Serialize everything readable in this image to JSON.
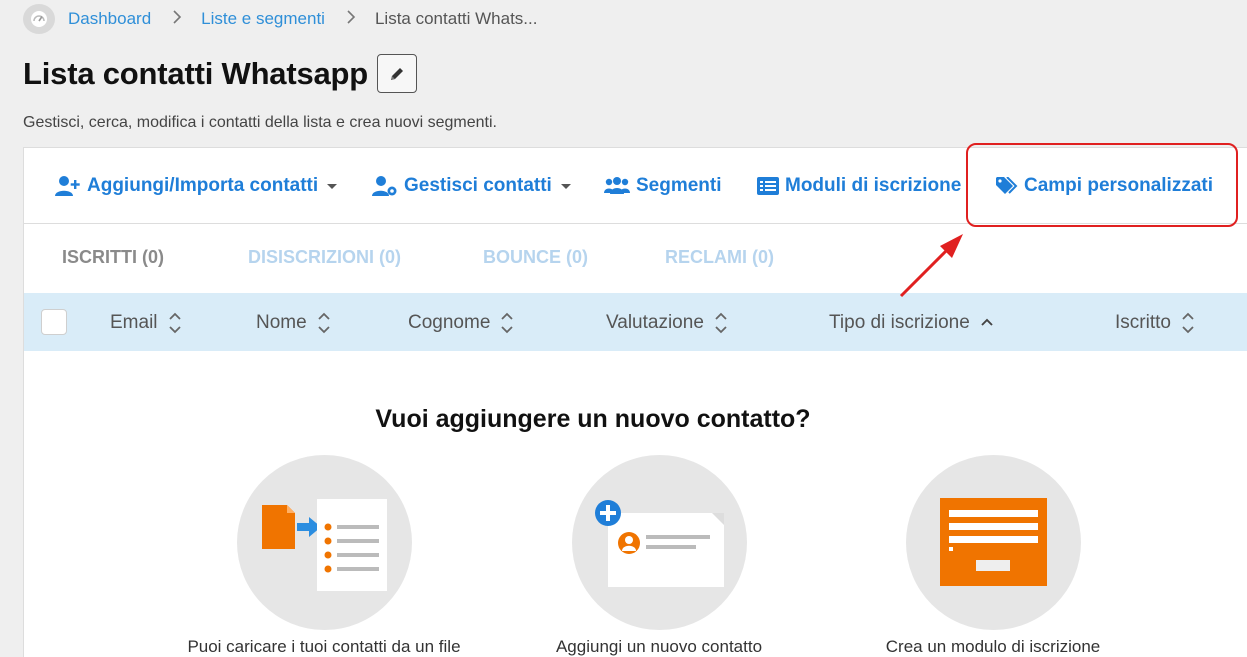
{
  "breadcrumb": {
    "home_icon": "speedometer-icon",
    "items": [
      "Dashboard",
      "Liste e segmenti"
    ],
    "current": "Lista contatti Whats..."
  },
  "page": {
    "title": "Lista contatti Whatsapp",
    "edit_icon": "pencil-icon",
    "subtitle": "Gestisci, cerca, modifica i contatti della lista e crea nuovi segmenti."
  },
  "toolbar": {
    "add_import": "Aggiungi/Importa contatti",
    "manage": "Gestisci contatti",
    "segments": "Segmenti",
    "forms": "Moduli di iscrizione",
    "custom_fields": "Campi personalizzati"
  },
  "tabs": [
    "ISCRITTI (0)",
    "DISISCRIZIONI (0)",
    "BOUNCE (0)",
    "RECLAMI (0)"
  ],
  "columns": [
    "Email",
    "Nome",
    "Cognome",
    "Valutazione",
    "Tipo di iscrizione",
    "Iscritto"
  ],
  "empty_state": {
    "title": "Vuoi aggiungere un nuovo contatto?",
    "options": [
      "Puoi caricare i tuoi contatti da un file",
      "Aggiungi un nuovo contatto",
      "Crea un modulo di iscrizione"
    ]
  },
  "colors": {
    "link": "#1f7ed8",
    "header_bg": "#d9ecf8",
    "accent_orange": "#f07400",
    "annotation_red": "#e02020"
  }
}
